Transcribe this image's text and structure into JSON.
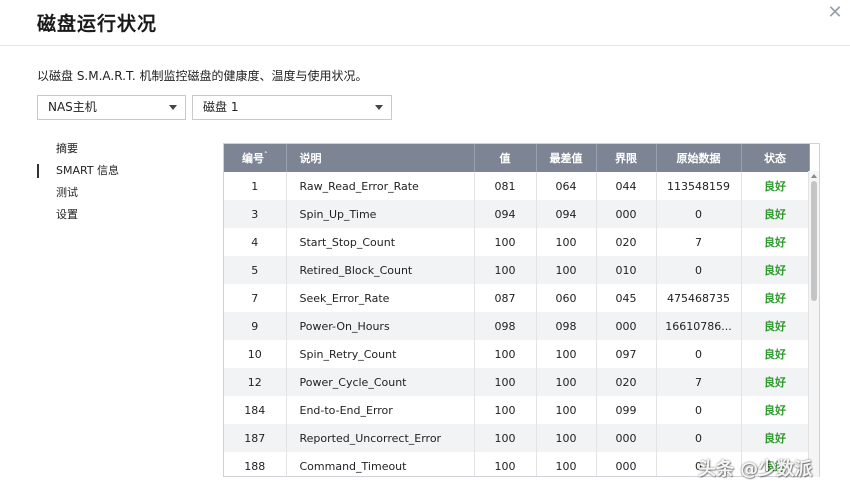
{
  "window": {
    "title": "磁盘运行状况",
    "close_icon": "close-icon"
  },
  "description": "以磁盘 S.M.A.R.T. 机制监控磁盘的健康度、温度与使用状况。",
  "selects": {
    "host": "NAS主机",
    "disk": "磁盘 1"
  },
  "nav": [
    {
      "label": "摘要",
      "active": false
    },
    {
      "label": "SMART 信息",
      "active": true
    },
    {
      "label": "测试",
      "active": false
    },
    {
      "label": "设置",
      "active": false
    }
  ],
  "table": {
    "headers": [
      "编号",
      "说明",
      "值",
      "最差值",
      "界限",
      "原始数据",
      "状态"
    ],
    "sort_indicator": "˄",
    "rows": [
      [
        "1",
        "Raw_Read_Error_Rate",
        "081",
        "064",
        "044",
        "113548159",
        "良好"
      ],
      [
        "3",
        "Spin_Up_Time",
        "094",
        "094",
        "000",
        "0",
        "良好"
      ],
      [
        "4",
        "Start_Stop_Count",
        "100",
        "100",
        "020",
        "7",
        "良好"
      ],
      [
        "5",
        "Retired_Block_Count",
        "100",
        "100",
        "010",
        "0",
        "良好"
      ],
      [
        "7",
        "Seek_Error_Rate",
        "087",
        "060",
        "045",
        "475468735",
        "良好"
      ],
      [
        "9",
        "Power-On_Hours",
        "098",
        "098",
        "000",
        "16610786...",
        "良好"
      ],
      [
        "10",
        "Spin_Retry_Count",
        "100",
        "100",
        "097",
        "0",
        "良好"
      ],
      [
        "12",
        "Power_Cycle_Count",
        "100",
        "100",
        "020",
        "7",
        "良好"
      ],
      [
        "184",
        "End-to-End_Error",
        "100",
        "100",
        "099",
        "0",
        "良好"
      ],
      [
        "187",
        "Reported_Uncorrect_Error",
        "100",
        "100",
        "000",
        "0",
        "良好"
      ],
      [
        "188",
        "Command_Timeout",
        "100",
        "100",
        "000",
        "0",
        "良好"
      ]
    ]
  },
  "watermark": "头条 @少数派",
  "colors": {
    "header_bg": "#7d8595",
    "status_good": "#2f9b2f"
  }
}
